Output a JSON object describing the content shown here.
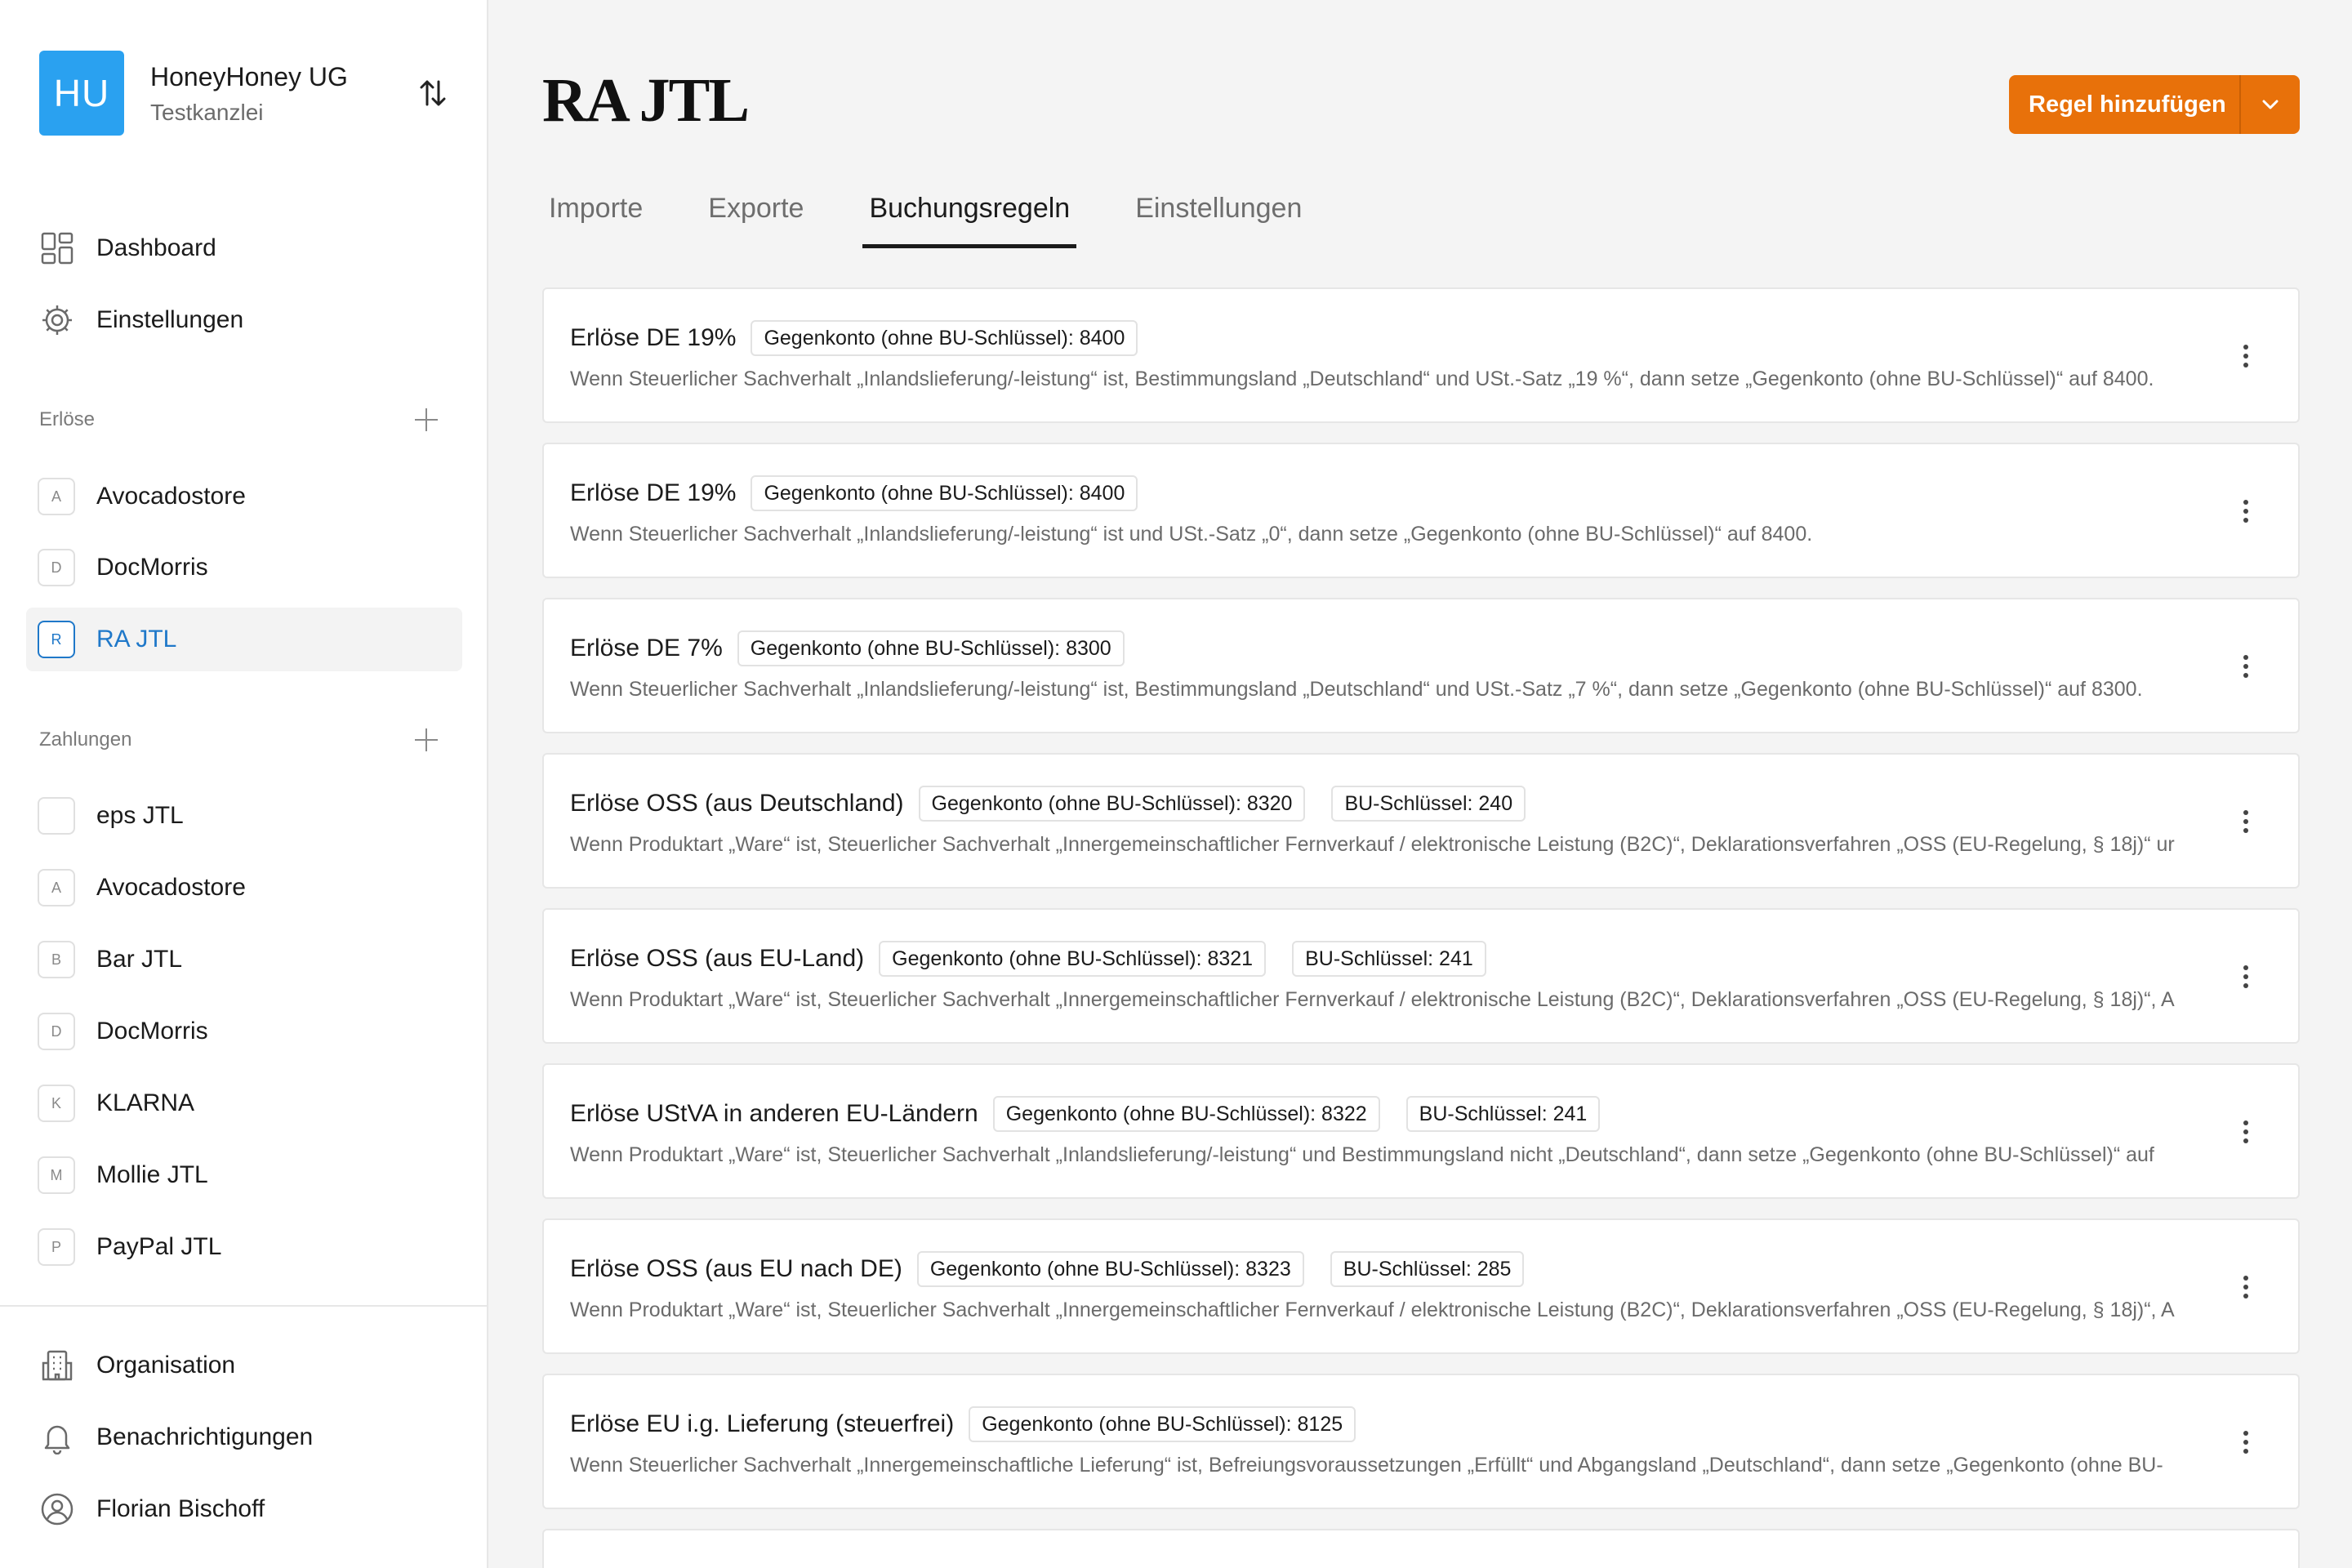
{
  "org": {
    "initials": "HU",
    "name": "HoneyHoney UG",
    "subtitle": "Testkanzlei"
  },
  "nav": {
    "dashboard": "Dashboard",
    "settings": "Einstellungen"
  },
  "revenue": {
    "heading": "Erlöse",
    "items": [
      {
        "badge": "A",
        "label": "Avocadostore"
      },
      {
        "badge": "D",
        "label": "DocMorris"
      },
      {
        "badge": "R",
        "label": "RA JTL"
      }
    ]
  },
  "payments": {
    "heading": "Zahlungen",
    "items": [
      {
        "badge": "",
        "label": "eps JTL"
      },
      {
        "badge": "A",
        "label": "Avocadostore"
      },
      {
        "badge": "B",
        "label": "Bar JTL"
      },
      {
        "badge": "D",
        "label": "DocMorris"
      },
      {
        "badge": "K",
        "label": "KLARNA"
      },
      {
        "badge": "M",
        "label": "Mollie JTL"
      },
      {
        "badge": "P",
        "label": "PayPal JTL"
      }
    ]
  },
  "footer": {
    "organisation": "Organisation",
    "notifications": "Benachrichtigungen",
    "user": "Florian Bischoff"
  },
  "page": {
    "title": "RA JTL",
    "add_button": "Regel hinzufügen"
  },
  "tabs": [
    "Importe",
    "Exporte",
    "Buchungsregeln",
    "Einstellungen"
  ],
  "rules": [
    {
      "title": "Erlöse DE 19%",
      "chips": [
        "Gegenkonto (ohne BU-Schlüssel): 8400"
      ],
      "desc": "Wenn Steuerlicher Sachverhalt „Inlandslieferung/-leistung“ ist, Bestimmungsland „Deutschland“ und USt.-Satz „19 %“, dann setze „Gegenkonto (ohne BU-Schlüssel)“ auf 8400."
    },
    {
      "title": "Erlöse DE 19%",
      "chips": [
        "Gegenkonto (ohne BU-Schlüssel): 8400"
      ],
      "desc": "Wenn Steuerlicher Sachverhalt „Inlandslieferung/-leistung“ ist und USt.-Satz „0“, dann setze „Gegenkonto (ohne BU-Schlüssel)“ auf 8400."
    },
    {
      "title": "Erlöse DE 7%",
      "chips": [
        "Gegenkonto (ohne BU-Schlüssel): 8300"
      ],
      "desc": "Wenn Steuerlicher Sachverhalt „Inlandslieferung/-leistung“ ist, Bestimmungsland „Deutschland“ und USt.-Satz „7 %“, dann setze „Gegenkonto (ohne BU-Schlüssel)“ auf 8300."
    },
    {
      "title": "Erlöse OSS (aus Deutschland)",
      "chips": [
        "Gegenkonto (ohne BU-Schlüssel): 8320",
        "BU-Schlüssel: 240"
      ],
      "desc": "Wenn Produktart „Ware“ ist, Steuerlicher Sachverhalt „Innergemeinschaftlicher Fernverkauf / elektronische Leistung (B2C)“, Deklarationsverfahren „OSS (EU-Regelung, § 18j)“ ur"
    },
    {
      "title": "Erlöse OSS (aus EU-Land)",
      "chips": [
        "Gegenkonto (ohne BU-Schlüssel): 8321",
        "BU-Schlüssel: 241"
      ],
      "desc": "Wenn Produktart „Ware“ ist, Steuerlicher Sachverhalt „Innergemeinschaftlicher Fernverkauf / elektronische Leistung (B2C)“, Deklarationsverfahren „OSS (EU-Regelung, § 18j)“, A"
    },
    {
      "title": "Erlöse UStVA in anderen EU-Ländern",
      "chips": [
        "Gegenkonto (ohne BU-Schlüssel): 8322",
        "BU-Schlüssel: 241"
      ],
      "desc": "Wenn Produktart „Ware“ ist, Steuerlicher Sachverhalt „Inlandslieferung/-leistung“ und Bestimmungsland nicht „Deutschland“, dann setze „Gegenkonto (ohne BU-Schlüssel)“ auf"
    },
    {
      "title": "Erlöse OSS (aus EU nach DE)",
      "chips": [
        "Gegenkonto (ohne BU-Schlüssel): 8323",
        "BU-Schlüssel: 285"
      ],
      "desc": "Wenn Produktart „Ware“ ist, Steuerlicher Sachverhalt „Innergemeinschaftlicher Fernverkauf / elektronische Leistung (B2C)“, Deklarationsverfahren „OSS (EU-Regelung, § 18j)“, A"
    },
    {
      "title": "Erlöse EU i.g. Lieferung (steuerfrei)",
      "chips": [
        "Gegenkonto (ohne BU-Schlüssel): 8125"
      ],
      "desc": "Wenn Steuerlicher Sachverhalt „Innergemeinschaftliche Lieferung“ ist, Befreiungsvoraussetzungen „Erfüllt“ und Abgangsland „Deutschland“, dann setze „Gegenkonto (ohne BU-"
    }
  ],
  "colors": {
    "accent": "#e8710a",
    "active": "#1f78c9",
    "avatar": "#2aa1f0"
  }
}
